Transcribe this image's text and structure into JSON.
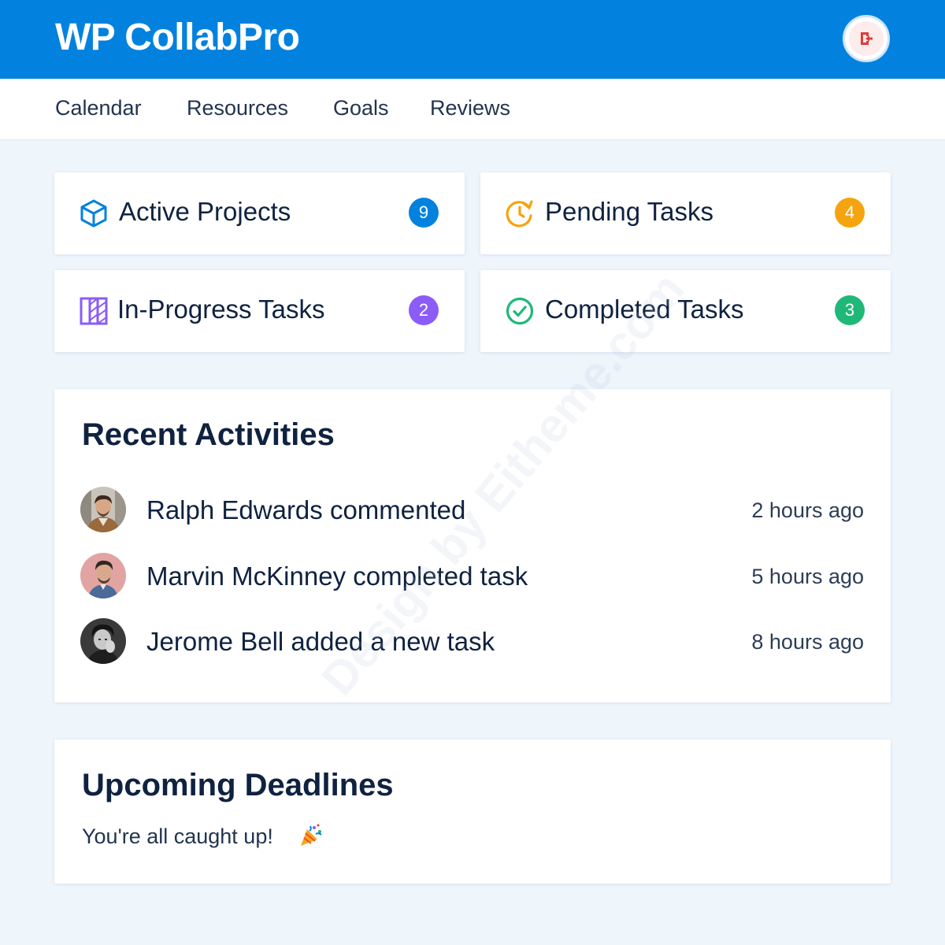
{
  "header": {
    "title": "WP CollabPro",
    "avatar_icon": "logout-icon",
    "background": "#0282de"
  },
  "nav": {
    "items": [
      "Calendar",
      "Resources",
      "Goals",
      "Reviews"
    ]
  },
  "stats": [
    {
      "label": "Active Projects",
      "count": "9",
      "icon": "cube-icon",
      "color": "#0282de"
    },
    {
      "label": "Pending Tasks",
      "count": "4",
      "icon": "clock-refresh-icon",
      "color": "#f5a30f"
    },
    {
      "label": "In-Progress Tasks",
      "count": "2",
      "icon": "columns-icon",
      "color": "#8b5cf6"
    },
    {
      "label": "Completed Tasks",
      "count": "3",
      "icon": "check-circle-icon",
      "color": "#1fb879"
    }
  ],
  "recent": {
    "title": "Recent Activities",
    "items": [
      {
        "text": "Ralph Edwards commented",
        "time": "2 hours ago"
      },
      {
        "text": "Marvin McKinney completed task",
        "time": "5 hours ago"
      },
      {
        "text": "Jerome Bell added a new task",
        "time": "8 hours ago"
      }
    ]
  },
  "deadlines": {
    "title": "Upcoming Deadlines",
    "message": "You're all caught up!",
    "icon": "party-popper-icon"
  },
  "watermark": "Design by Eitheme.com"
}
